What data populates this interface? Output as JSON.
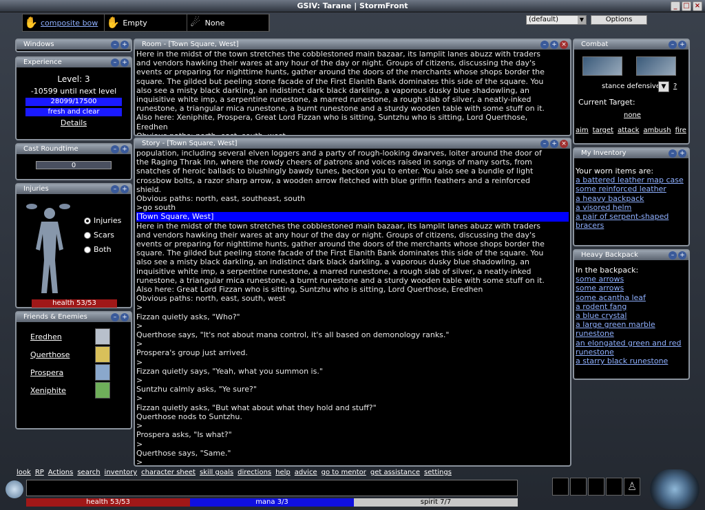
{
  "window": {
    "title": "GSIV: Tarane | StormFront"
  },
  "hands": [
    {
      "label": "composite bow",
      "link": true
    },
    {
      "label": "Empty",
      "link": false
    },
    {
      "label": "None",
      "link": false
    }
  ],
  "topright": {
    "layout_select": "(default)",
    "options_label": "Options"
  },
  "panels": {
    "windows": {
      "title": "Windows"
    },
    "experience": {
      "title": "Experience",
      "level": "Level: 3",
      "next": "-10599 until next level",
      "exp_bar": "28099/17500",
      "mind_bar": "fresh and clear",
      "details": "Details"
    },
    "roundtime": {
      "title": "Cast Roundtime",
      "value": "0"
    },
    "injuries": {
      "title": "Injuries",
      "options": [
        "Injuries",
        "Scars",
        "Both"
      ],
      "health": "health 53/53"
    },
    "friends": {
      "title": "Friends & Enemies",
      "names": [
        "Eredhen",
        "Querthose",
        "Prospera",
        "Xeniphite"
      ]
    },
    "room": {
      "title": "Room - [Town Square, West]"
    },
    "story": {
      "title": "Story - [Town Square, West]"
    },
    "combat": {
      "title": "Combat",
      "stance": "stance defensive",
      "help": "?",
      "target_label": "Current Target:",
      "target": "none",
      "actions": [
        "aim",
        "target",
        "attack",
        "ambush",
        "fire"
      ]
    },
    "inventory": {
      "title": "My Inventory",
      "intro": "Your worn items are:",
      "items": [
        "a battered leather map case",
        "some reinforced leather",
        "a heavy backpack",
        "a visored helm",
        "a pair of serpent-shaped bracers"
      ]
    },
    "backpack": {
      "title": "Heavy Backpack",
      "intro": "In the backpack:",
      "items": [
        "some arrows",
        "some arrows",
        "some acantha leaf",
        "a rodent fang",
        "a blue crystal",
        "a large green marble runestone",
        "an elongated green and red runestone",
        "a starry black runestone"
      ]
    }
  },
  "room_lines": [
    "Here in the midst of the town stretches the cobblestoned main bazaar, its lamplit lanes abuzz with traders",
    "and vendors hawking their wares at any hour of the day or night.  Groups of citizens, discussing the day's",
    "events or preparing for nighttime hunts, gather around the doors of the merchants whose shops border the",
    "square.  The gilded but peeling stone facade of the First Elanith Bank dominates this side of the square.  You",
    "also see a misty black darkling, an indistinct dark black darkling, a vaporous dusky blue shadowling, an",
    "inquisitive white imp, a serpentine runestone, a marred runestone, a rough slab of silver, a neatly-inked",
    "runestone, a triangular mica runestone, a burnt runestone and a sturdy wooden table with some stuff on it.",
    "Also here:  Xeniphite,  Prospera, Great Lord Fizzan who is sitting,  Suntzhu who is sitting, Lord Querthose,",
    "Eredhen",
    "Obvious paths: north, east, south, west"
  ],
  "story_lines": [
    "population, including several elven loggers and a party of rough-looking dwarves, loiter around the door of",
    "the Raging Thrak Inn, where the rowdy cheers of patrons and voices raised in songs of many sorts, from",
    "snatches of heroic ballads to blushingly bawdy tunes, beckon you to enter.  You also see a bundle of light",
    "crossbow bolts, a razor sharp arrow, a wooden arrow fletched with blue griffin feathers and a reinforced",
    "shield.",
    "Obvious paths: north, east, southeast, south",
    ">go south",
    "[Town Square, West]",
    "Here in the midst of the town stretches the cobblestoned main bazaar, its lamplit lanes abuzz with traders",
    "and vendors hawking their wares at any hour of the day or night.  Groups of citizens, discussing the day's",
    "events or preparing for nighttime hunts, gather around the doors of the merchants whose shops border the",
    "square.  The gilded but peeling stone facade of the First Elanith Bank dominates this side of the square.  You",
    "also see a misty black darkling, an indistinct dark black darkling, a vaporous dusky blue shadowling, an",
    "inquisitive white imp, a serpentine runestone, a marred runestone, a rough slab of silver, a neatly-inked",
    "runestone, a triangular mica runestone, a burnt runestone and a sturdy wooden table with some stuff on it.",
    "Also here: Great Lord Fizzan who is sitting, Suntzhu who is sitting, Lord Querthose, Eredhen",
    "Obvious paths: north, east, south, west",
    ">",
    "Fizzan quietly asks, \"Who?\"",
    ">",
    "Querthose says, \"It's not about mana control, it's all based on demonology ranks.\"",
    ">",
    "Prospera's group just arrived.",
    ">",
    "Fizzan quietly says, \"Yeah, what you summon is.\"",
    ">",
    "Suntzhu calmly asks, \"Ye sure?\"",
    ">",
    "Fizzan quietly asks, \"But what about what they hold and stuff?\"",
    "Querthose nods to Suntzhu.",
    ">",
    "Prospera asks, \"Is what?\"",
    ">",
    "Querthose says, \"Same.\"",
    ">"
  ],
  "commands": [
    "look",
    "RP",
    "Actions",
    "search",
    "inventory",
    "character sheet",
    "skill goals",
    "directions",
    "help",
    "advice",
    "go to mentor",
    "get assistance",
    "settings"
  ],
  "status": {
    "health": "health 53/53",
    "mana": "mana 3/3",
    "spirit": "spirit 7/7"
  },
  "colors": {
    "exp_blue": "#1a1aff",
    "health_red": "#a01818",
    "mana_blue": "#1010e0",
    "spirit_gray": "#c8c8c8",
    "link": "#8fb0ff",
    "speech": "#7fd07f"
  }
}
